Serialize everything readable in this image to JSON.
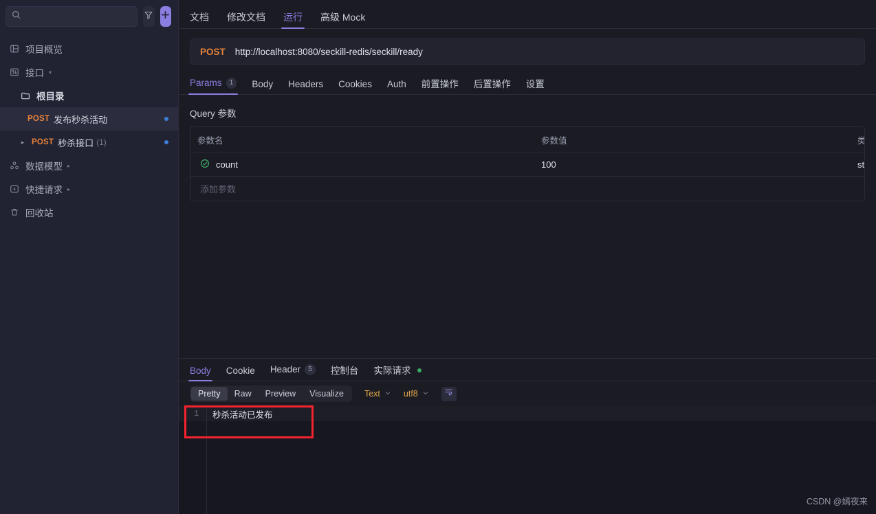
{
  "sidebar": {
    "search": {
      "placeholder": "",
      "value": ""
    },
    "filter_icon": "filter-icon",
    "add_icon": "plus-icon",
    "items": [
      {
        "label": "项目概览",
        "icon": "layout-icon",
        "caret": ""
      },
      {
        "label": "接口",
        "icon": "api-icon",
        "caret": "▾"
      },
      {
        "label": "根目录",
        "icon": "folder-icon"
      },
      {
        "method": "POST",
        "label": "发布秒杀活动",
        "count": "",
        "selected": true
      },
      {
        "method": "POST",
        "label": "秒杀接口",
        "count": "(1)",
        "selected": false
      },
      {
        "label": "数据模型",
        "icon": "model-icon",
        "caret": "▸"
      },
      {
        "label": "快捷请求",
        "icon": "bolt-icon",
        "caret": "▸"
      },
      {
        "label": "回收站",
        "icon": "trash-icon",
        "caret": ""
      }
    ]
  },
  "top_tabs": [
    {
      "label": "文档",
      "active": false
    },
    {
      "label": "修改文档",
      "active": false
    },
    {
      "label": "运行",
      "active": true
    },
    {
      "label": "高级 Mock",
      "active": false
    }
  ],
  "url_bar": {
    "method": "POST",
    "url": "http://localhost:8080/seckill-redis/seckill/ready"
  },
  "request_tabs": [
    {
      "label": "Params",
      "badge": "1",
      "active": true
    },
    {
      "label": "Body",
      "badge": "",
      "active": false
    },
    {
      "label": "Headers",
      "badge": "",
      "active": false
    },
    {
      "label": "Cookies",
      "badge": "",
      "active": false
    },
    {
      "label": "Auth",
      "badge": "",
      "active": false
    },
    {
      "label": "前置操作",
      "badge": "",
      "active": false
    },
    {
      "label": "后置操作",
      "badge": "",
      "active": false
    },
    {
      "label": "设置",
      "badge": "",
      "active": false
    }
  ],
  "params": {
    "title": "Query 参数",
    "headers": [
      "参数名",
      "参数值",
      "类型"
    ],
    "rows": [
      {
        "enabled_icon": "check-circle-icon",
        "name": "count",
        "value": "100",
        "type": "string"
      }
    ],
    "add_row_placeholder": "添加参数"
  },
  "response": {
    "tabs": [
      {
        "label": "Body",
        "badge": "",
        "dot": false,
        "active": true
      },
      {
        "label": "Cookie",
        "badge": "",
        "dot": false,
        "active": false
      },
      {
        "label": "Header",
        "badge": "5",
        "dot": false,
        "active": false
      },
      {
        "label": "控制台",
        "badge": "",
        "dot": false,
        "active": false
      },
      {
        "label": "实际请求",
        "badge": "",
        "dot": true,
        "active": false
      }
    ],
    "view_modes": [
      {
        "label": "Pretty",
        "active": true
      },
      {
        "label": "Raw",
        "active": false
      },
      {
        "label": "Preview",
        "active": false
      },
      {
        "label": "Visualize",
        "active": false
      }
    ],
    "format_select": "Text",
    "encoding_select": "utf8",
    "wrap_icon": "wrap-lines-icon",
    "body_lines": [
      {
        "number": "1",
        "text": "秒杀活动已发布"
      }
    ]
  },
  "watermark": "CSDN @嫣夜来",
  "colors": {
    "accent": "#8a7ee0",
    "method_post": "#e8833a",
    "type_string": "#4aa87a",
    "highlight_box": "#f5232e",
    "bg_main": "#1a1b23",
    "bg_sidebar": "#212232"
  }
}
